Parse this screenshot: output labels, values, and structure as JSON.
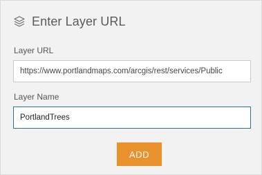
{
  "header": {
    "title": "Enter Layer URL",
    "icon": "layers-icon"
  },
  "form": {
    "url_label": "Layer URL",
    "url_value": "https://www.portlandmaps.com/arcgis/rest/services/Public",
    "name_label": "Layer Name",
    "name_value": "PortlandTrees"
  },
  "actions": {
    "add_label": "ADD"
  },
  "colors": {
    "panel_background": "#f2f2f2",
    "accent_button": "#e8912d",
    "focused_border": "#2d6e9e"
  }
}
